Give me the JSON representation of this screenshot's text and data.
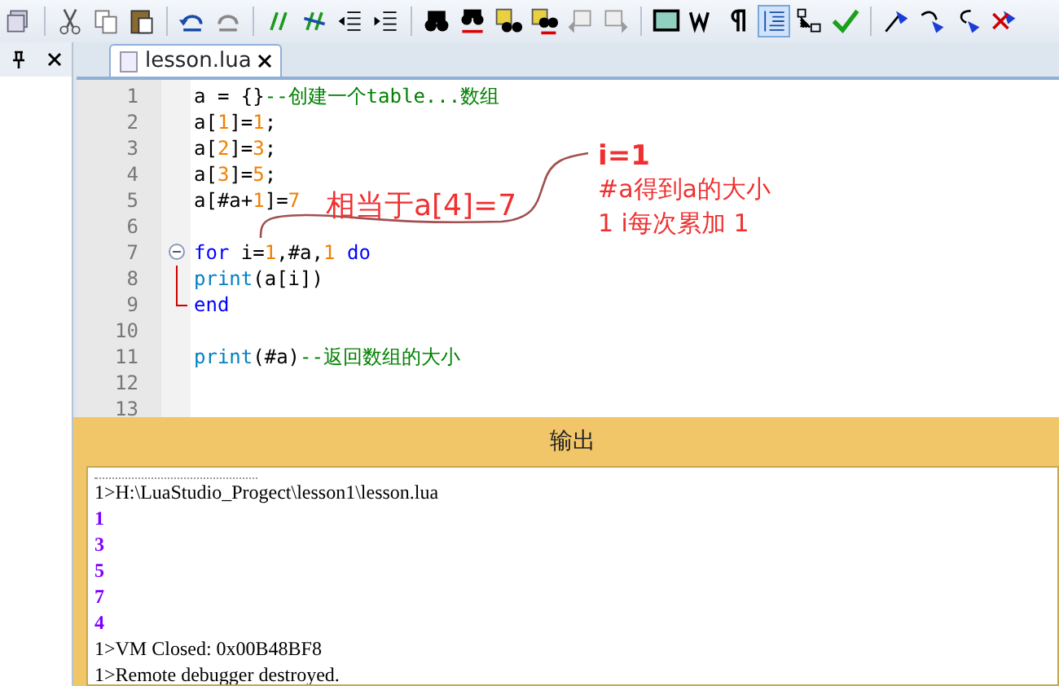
{
  "tab": {
    "label": "lesson.lua",
    "selected": true
  },
  "editor": {
    "lines": [
      {
        "number": "1",
        "tokens": [
          {
            "kind": "id",
            "text": "a = {}"
          },
          {
            "kind": "comment",
            "text": "--创建一个table...数组"
          }
        ]
      },
      {
        "number": "2",
        "tokens": [
          {
            "kind": "id",
            "text": "a["
          },
          {
            "kind": "num",
            "text": "1"
          },
          {
            "kind": "id",
            "text": "]="
          },
          {
            "kind": "num",
            "text": "1"
          },
          {
            "kind": "id",
            "text": ";"
          }
        ]
      },
      {
        "number": "3",
        "tokens": [
          {
            "kind": "id",
            "text": "a["
          },
          {
            "kind": "num",
            "text": "2"
          },
          {
            "kind": "id",
            "text": "]="
          },
          {
            "kind": "num",
            "text": "3"
          },
          {
            "kind": "id",
            "text": ";"
          }
        ]
      },
      {
        "number": "4",
        "tokens": [
          {
            "kind": "id",
            "text": "a["
          },
          {
            "kind": "num",
            "text": "3"
          },
          {
            "kind": "id",
            "text": "]="
          },
          {
            "kind": "num",
            "text": "5"
          },
          {
            "kind": "id",
            "text": ";"
          }
        ]
      },
      {
        "number": "5",
        "tokens": [
          {
            "kind": "id",
            "text": "a[#a+"
          },
          {
            "kind": "num",
            "text": "1"
          },
          {
            "kind": "id",
            "text": "]="
          },
          {
            "kind": "num",
            "text": "7"
          }
        ]
      },
      {
        "number": "6"
      },
      {
        "number": "7",
        "fold": {
          "expanded": true
        },
        "tokens": [
          {
            "kind": "kw",
            "text": "for"
          },
          {
            "kind": "id",
            "text": " i="
          },
          {
            "kind": "num",
            "text": "1"
          },
          {
            "kind": "id",
            "text": ",#a,"
          },
          {
            "kind": "num",
            "text": "1"
          },
          {
            "kind": "kw",
            "text": " do"
          }
        ]
      },
      {
        "number": "8",
        "tokens": [
          {
            "kind": "fn",
            "text": "print"
          },
          {
            "kind": "id",
            "text": "(a[i])"
          }
        ]
      },
      {
        "number": "9",
        "tokens": [
          {
            "kind": "kw",
            "text": "end"
          }
        ]
      },
      {
        "number": "10"
      },
      {
        "number": "11",
        "tokens": [
          {
            "kind": "fn",
            "text": "print"
          },
          {
            "kind": "id",
            "text": "(#a)"
          },
          {
            "kind": "comment",
            "text": "--返回数组的大小"
          }
        ]
      },
      {
        "number": "12"
      },
      {
        "number": "13"
      }
    ]
  },
  "annotations": {
    "inline": "相当于a[4]=7",
    "notes": [
      "i=1",
      "#a得到a的大小",
      "1 i每次累加 1"
    ]
  },
  "output": {
    "title": "输出",
    "lines": [
      {
        "kind": "log",
        "text": "1>H:\\LuaStudio_Progect\\lesson1\\lesson.lua"
      },
      {
        "kind": "value",
        "text": "1"
      },
      {
        "kind": "value",
        "text": "3"
      },
      {
        "kind": "value",
        "text": "5"
      },
      {
        "kind": "value",
        "text": "7"
      },
      {
        "kind": "value",
        "text": "4"
      },
      {
        "kind": "log",
        "text": "1>VM Closed: 0x00B48BF8"
      },
      {
        "kind": "log",
        "text": "1>Remote debugger destroyed."
      }
    ]
  }
}
